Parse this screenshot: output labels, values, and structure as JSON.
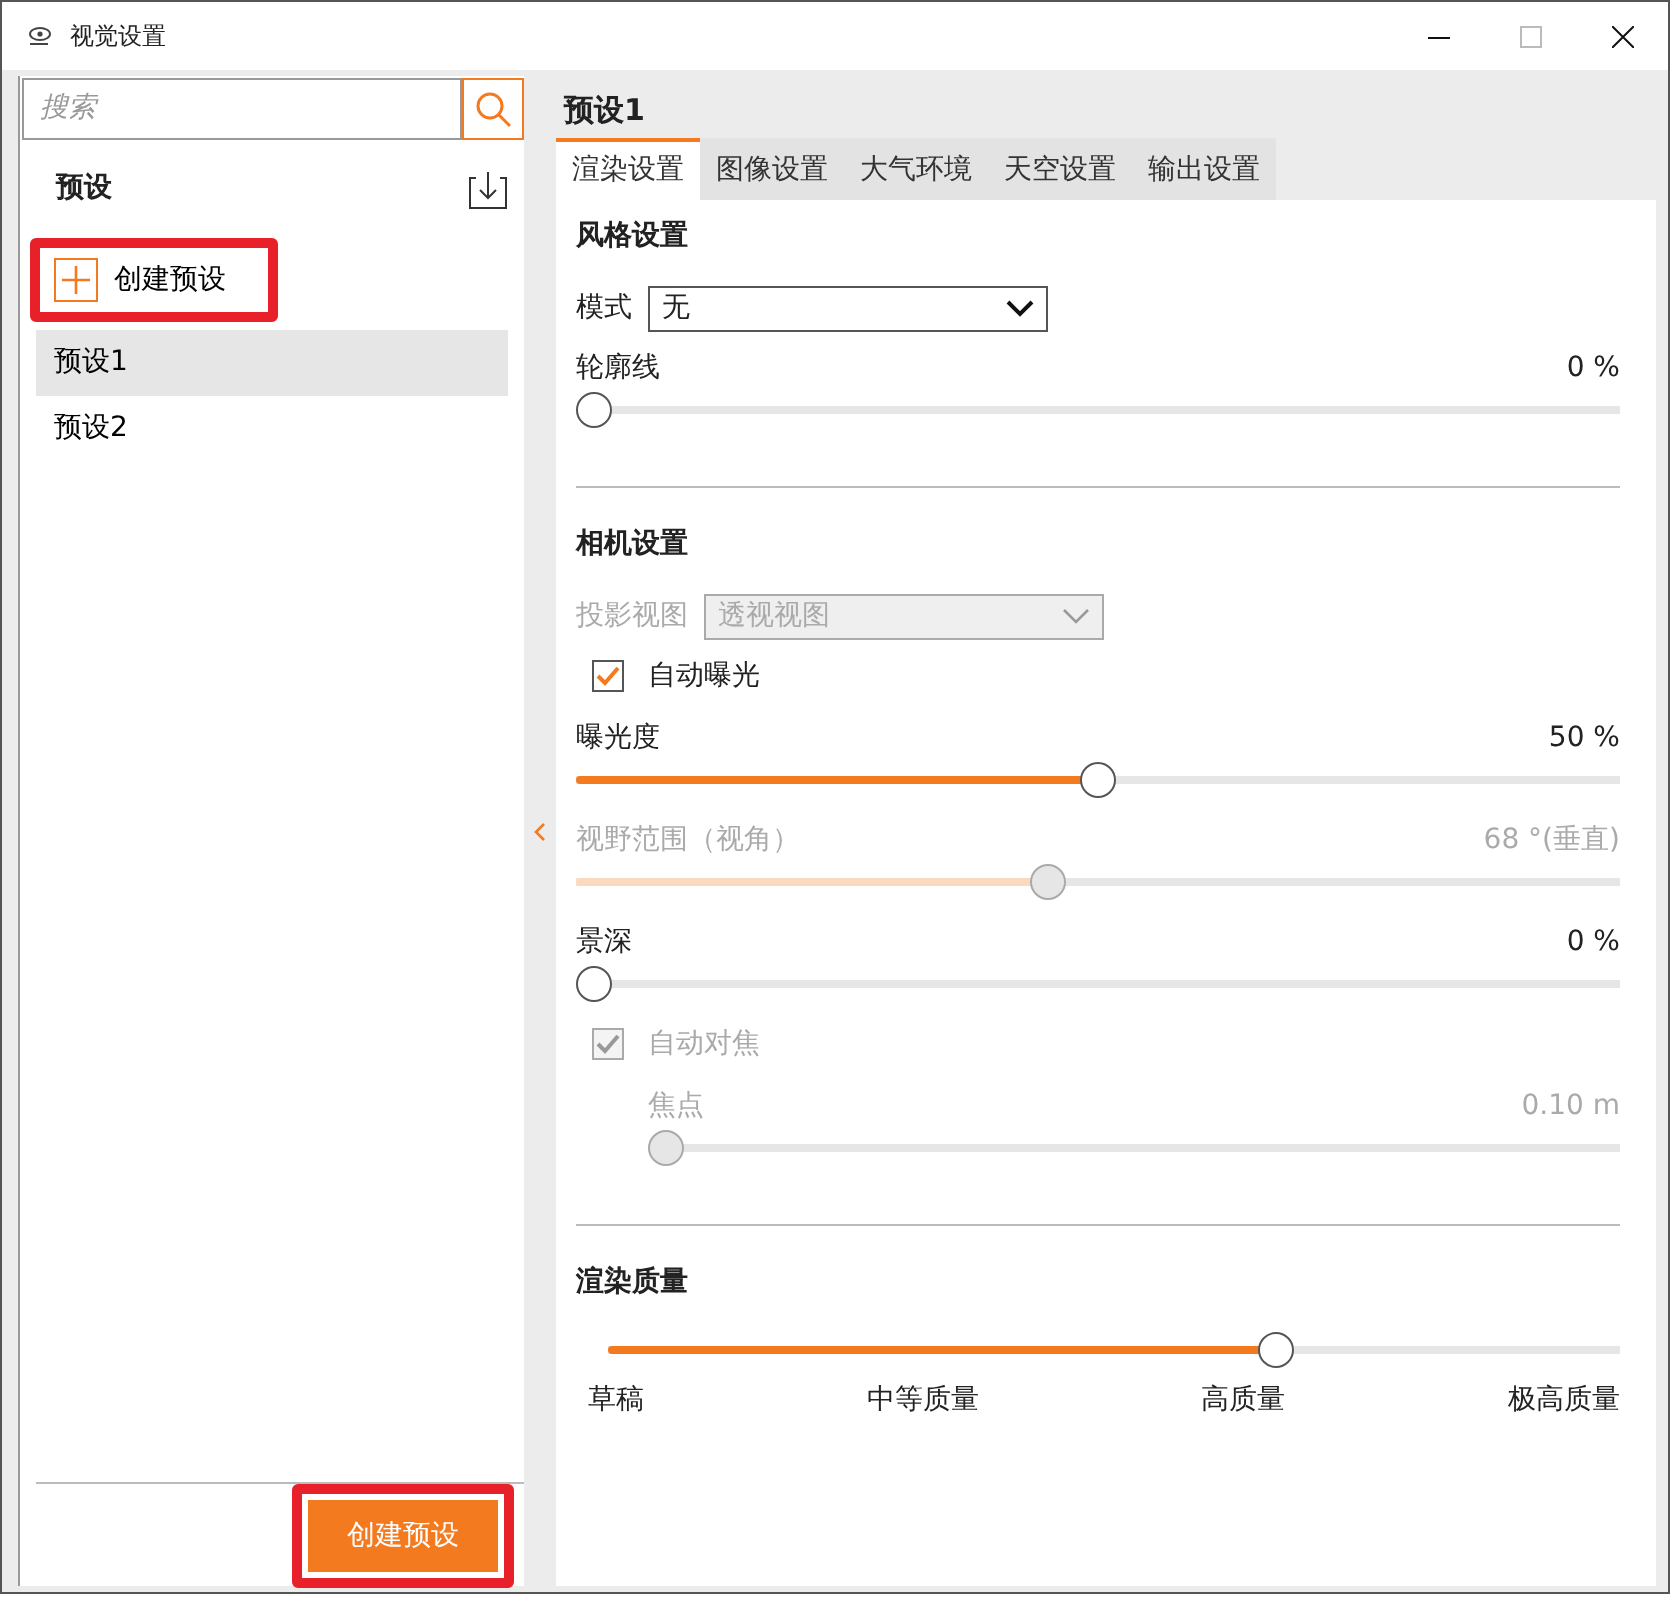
{
  "window": {
    "title": "视觉设置"
  },
  "sidebar": {
    "search": {
      "placeholder": "搜索"
    },
    "heading": "预设",
    "create_item": {
      "label": "创建预设",
      "highlighted": true
    },
    "presets": [
      {
        "label": "预设1",
        "selected": true
      },
      {
        "label": "预设2",
        "selected": false
      }
    ],
    "footer_button": {
      "label": "创建预设",
      "highlighted": true
    }
  },
  "main": {
    "title": "预设1",
    "tabs": [
      {
        "label": "渲染设置",
        "selected": true
      },
      {
        "label": "图像设置",
        "selected": false
      },
      {
        "label": "大气环境",
        "selected": false
      },
      {
        "label": "天空设置",
        "selected": false
      },
      {
        "label": "输出设置",
        "selected": false
      }
    ],
    "sections": [
      {
        "title": "风格设置",
        "rows": [
          {
            "kind": "select",
            "label": "模式",
            "value": "无",
            "disabled": false
          },
          {
            "kind": "slider",
            "label": "轮廓线",
            "reading": "0 %",
            "level": 0,
            "disabled": false,
            "indented": false
          }
        ]
      },
      {
        "title": "相机设置",
        "rows": [
          {
            "kind": "select",
            "label": "投影视图",
            "value": "透视视图",
            "disabled": true
          },
          {
            "kind": "checkbox",
            "label": "自动曝光",
            "checked": true,
            "disabled": false
          },
          {
            "kind": "slider",
            "label": "曝光度",
            "reading": "50 %",
            "level": 0.5,
            "disabled": false,
            "indented": false
          },
          {
            "kind": "slider",
            "label": "视野范围（视角）",
            "reading": "68 °(垂直)",
            "level": 0.45,
            "disabled": true,
            "indented": false
          },
          {
            "kind": "slider",
            "label": "景深",
            "reading": "0 %",
            "level": 0,
            "disabled": false,
            "indented": false
          },
          {
            "kind": "checkbox",
            "label": "自动对焦",
            "checked": true,
            "disabled": true
          },
          {
            "kind": "slider",
            "label": "焦点",
            "reading": "0.10 m",
            "level": 0,
            "disabled": true,
            "indented": true
          }
        ]
      },
      {
        "title": "渲染质量",
        "rows": [
          {
            "kind": "steps",
            "level": 0.667,
            "steps": [
              "草稿",
              "中等质量",
              "高质量",
              "极高质量"
            ]
          }
        ]
      }
    ]
  }
}
